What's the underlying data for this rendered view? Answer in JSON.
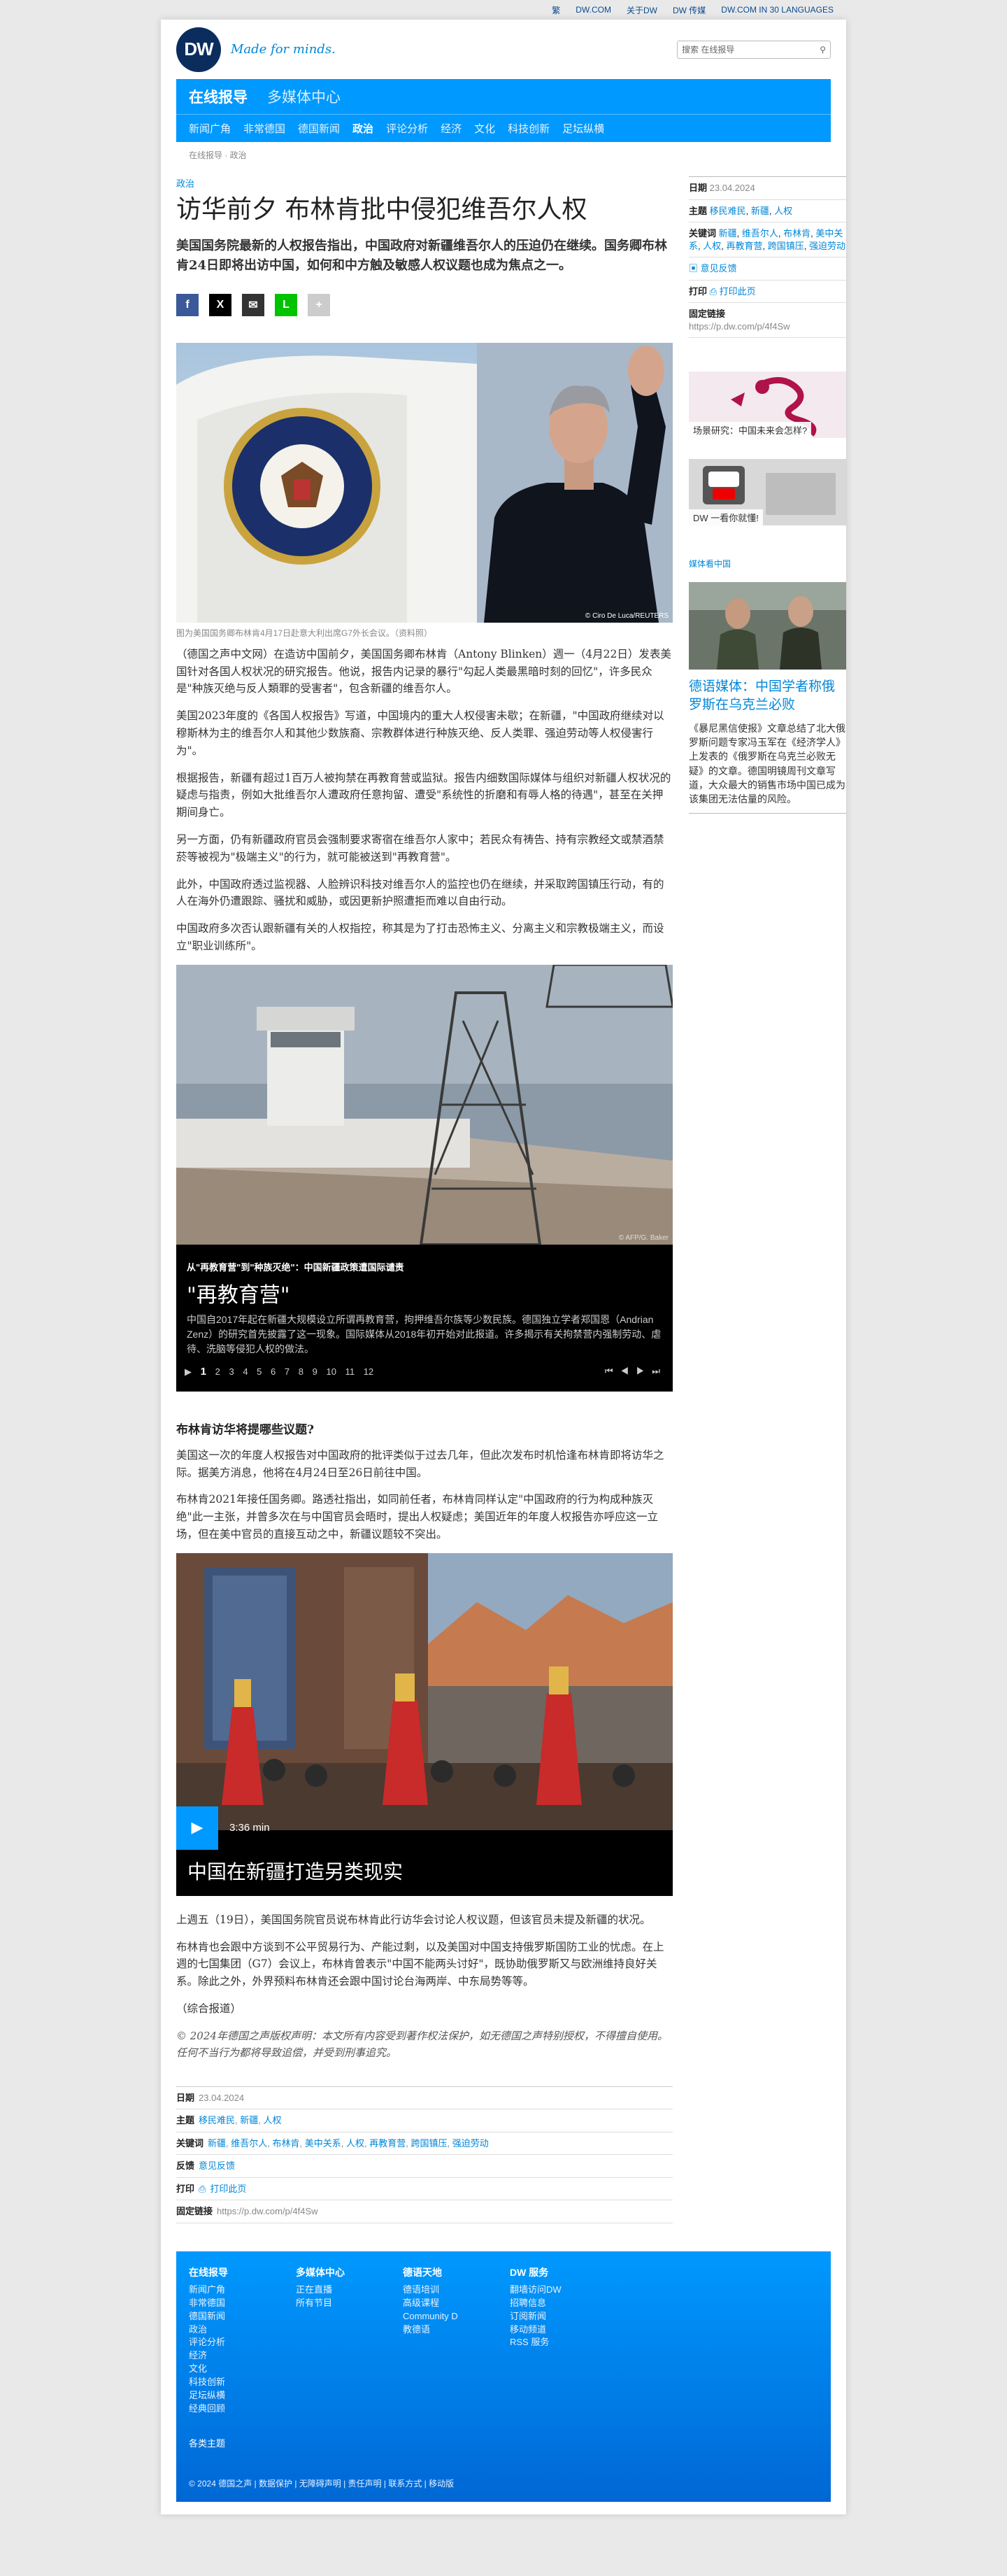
{
  "topbar": [
    "繁",
    "DW.COM",
    "关于DW",
    "DW 传媒",
    "DW.COM IN 30 LANGUAGES"
  ],
  "header": {
    "logo_text": "DW",
    "slogan": "Made for minds.",
    "search_placeholder": "搜索 在线报导",
    "search_icon": "search-icon"
  },
  "nav": {
    "primary": [
      "在线报导",
      "多媒体中心"
    ],
    "secondary": [
      "新闻广角",
      "非常德国",
      "德国新闻",
      "政治",
      "评论分析",
      "经济",
      "文化",
      "科技创新",
      "足坛纵横"
    ],
    "current": "政治"
  },
  "breadcrumb": "在线报导 · 政治",
  "article": {
    "kicker": "政治",
    "title": "访华前夕 布林肯批中侵犯维吾尔人权",
    "lead": "美国国务院最新的人权报告指出，中国政府对新疆维吾尔人的压迫仍在继续。国务卿布林肯24日即将出访中国，如何和中方触及敏感人权议题也成为焦点之一。",
    "share": [
      "f",
      "X",
      "✉",
      "L",
      "+"
    ],
    "photo_credit": "© Ciro De Luca/REUTERS",
    "photo_caption": "图为美国国务卿布林肯4月17日赴意大利出席G7外长会议。（资料照）",
    "paragraphs": [
      "（德国之声中文网）在造访中国前夕，美国国务卿布林肯（Antony Blinken）週一（4月22日）发表美国针对各国人权状况的研究报告。他说，报告内记录的暴行\"勾起人类最黑暗时刻的回忆\"，许多民众是\"种族灭绝与反人類罪的受害者\"，包含新疆的维吾尔人。",
      "美国2023年度的《各国人权报告》写道，中国境内的重大人权侵害未歇；在新疆，\"中国政府继续对以穆斯林为主的维吾尔人和其他少数族裔、宗教群体进行种族灭绝、反人类罪、强迫劳动等人权侵害行为\"。",
      "根据报告，新疆有超过1百万人被拘禁在再教育营或监狱。报告内细数国际媒体与组织对新疆人权状况的疑虑与指责，例如大批维吾尔人遭政府任意拘留、遭受\"系统性的折磨和有辱人格的待遇\"，甚至在关押期间身亡。",
      "另一方面，仍有新疆政府官员会强制要求寄宿在维吾尔人家中；若民众有祷告、持有宗教经文或禁酒禁菸等被视为\"极端主义\"的行为，就可能被送到\"再教育营\"。",
      "此外，中国政府透过监视器、人脸辨识科技对维吾尔人的监控也仍在继续，并采取跨国镇压行动，有的人在海外仍遭跟踪、骚扰和威胁，或因更新护照遭拒而难以自由行动。",
      "中国政府多次否认跟新疆有关的人权指控，称其是为了打击恐怖主义、分离主义和宗教极端主义，而设立\"职业训练所\"。"
    ],
    "gallery": {
      "credit": "© AFP/G. Baker",
      "kicker": "从\"再教育营\"到\"种族灭绝\"：中国新疆政策遭国际谴责",
      "title": "\"再教育营\"",
      "desc": "中国自2017年起在新疆大规模设立所谓再教育营，拘押维吾尔族等少数民族。德国独立学者郑国恩（Andrian Zenz）的研究首先披露了这一现象。国际媒体从2018年初开始对此报道。许多揭示有关拘禁营内强制劳动、虐待、洗脑等侵犯人权的做法。",
      "pages": [
        "1",
        "2",
        "3",
        "4",
        "5",
        "6",
        "7",
        "8",
        "9",
        "10",
        "11",
        "12"
      ],
      "controls": [
        "⏮",
        "◀",
        "▶",
        "⏭"
      ]
    },
    "section_heading": "布林肯访华将提哪些议题?",
    "paragraphs2": [
      "美国这一次的年度人权报告对中国政府的批评类似于过去几年，但此次发布时机恰逢布林肯即将访华之际。据美方消息，他将在4月24日至26日前往中国。",
      "布林肯2021年接任国务卿。路透社指出，如同前任者，布林肯同样认定\"中国政府的行为构成种族灭绝\"此一主张，并曾多次在与中国官员会晤时，提出人权疑虑；美国近年的年度人权报告亦呼应这一立场，但在美中官员的直接互动之中，新疆议题较不突出。"
    ],
    "video": {
      "duration": "3:36 min",
      "title": "中国在新疆打造另类现实"
    },
    "paragraphs3": [
      "上週五（19日），美国国务院官员说布林肯此行访华会讨论人权议题，但该官员未提及新疆的状况。",
      "布林肯也会跟中方谈到不公平贸易行为、产能过剩，以及美国对中国支持俄罗斯国防工业的忧虑。在上週的七国集团（G7）会议上，布林肯曾表示\"中国不能两头讨好\"，既协助俄罗斯又与欧洲维持良好关系。除此之外，外界预料布林肯还会跟中国讨论台海两岸、中东局势等等。",
      "（综合报道）"
    ],
    "copyright": "© 2024年德国之声版权声明：本文所有内容受到著作权法保护，如无德国之声特别授权，不得擅自使用。任何不当行为都将导致追偿，并受到刑事追究。"
  },
  "meta": {
    "date_label": "日期",
    "date": "23.04.2024",
    "topic_label": "主题",
    "topics": [
      "移民难民",
      "新疆",
      "人权"
    ],
    "keywords_label": "关键词",
    "keywords": [
      "新疆",
      "维吾尔人",
      "布林肯",
      "美中关系",
      "人权",
      "再教育营",
      "跨国镇压",
      "强迫劳动"
    ],
    "feedback_label": "反馈",
    "feedback": "意见反馈",
    "print_label": "打印",
    "print": "打印此页",
    "permalink_label": "固定链接",
    "permalink": "https://p.dw.com/p/4f4Sw"
  },
  "sidebar": {
    "teasers": [
      "场景研究：中国未来会怎样?",
      "DW 一看你就懂!"
    ],
    "media_kicker": "媒体看中国",
    "media_title": "德语媒体：中国学者称俄罗斯在乌克兰必败",
    "media_text": "《暴尼黑信使报》文章总结了北大俄罗斯问题专家冯玉军在《经济学人》上发表的《俄罗斯在乌克兰必败无疑》的文章。德国明镜周刊文章写道，大众最大的销售市场中国已成为该集团无法估量的风险。"
  },
  "footer": {
    "cols": [
      {
        "head": "在线报导",
        "items": [
          "新闻广角",
          "非常德国",
          "德国新闻",
          "政治",
          "评论分析",
          "经济",
          "文化",
          "科技创新",
          "足坛纵横",
          "经典回顾"
        ]
      },
      {
        "head": "多媒体中心",
        "items": [
          "正在直播",
          "所有节目"
        ]
      },
      {
        "head": "德语天地",
        "items": [
          "德语培训",
          "高级课程",
          "Community D",
          "教德语"
        ]
      },
      {
        "head": "DW 服务",
        "items": [
          "翻墙访问DW",
          "招聘信息",
          "订阅新闻",
          "移动频道",
          "RSS 服务"
        ]
      }
    ],
    "more": "各类主题",
    "bottom": "© 2024 德国之声 | 数据保护 | 无障碍声明 | 责任声明 | 联系方式 | 移动版"
  },
  "colors": {
    "brand_blue": "#0099ff",
    "link": "#0087d8",
    "navy": "#0a2d5e"
  }
}
